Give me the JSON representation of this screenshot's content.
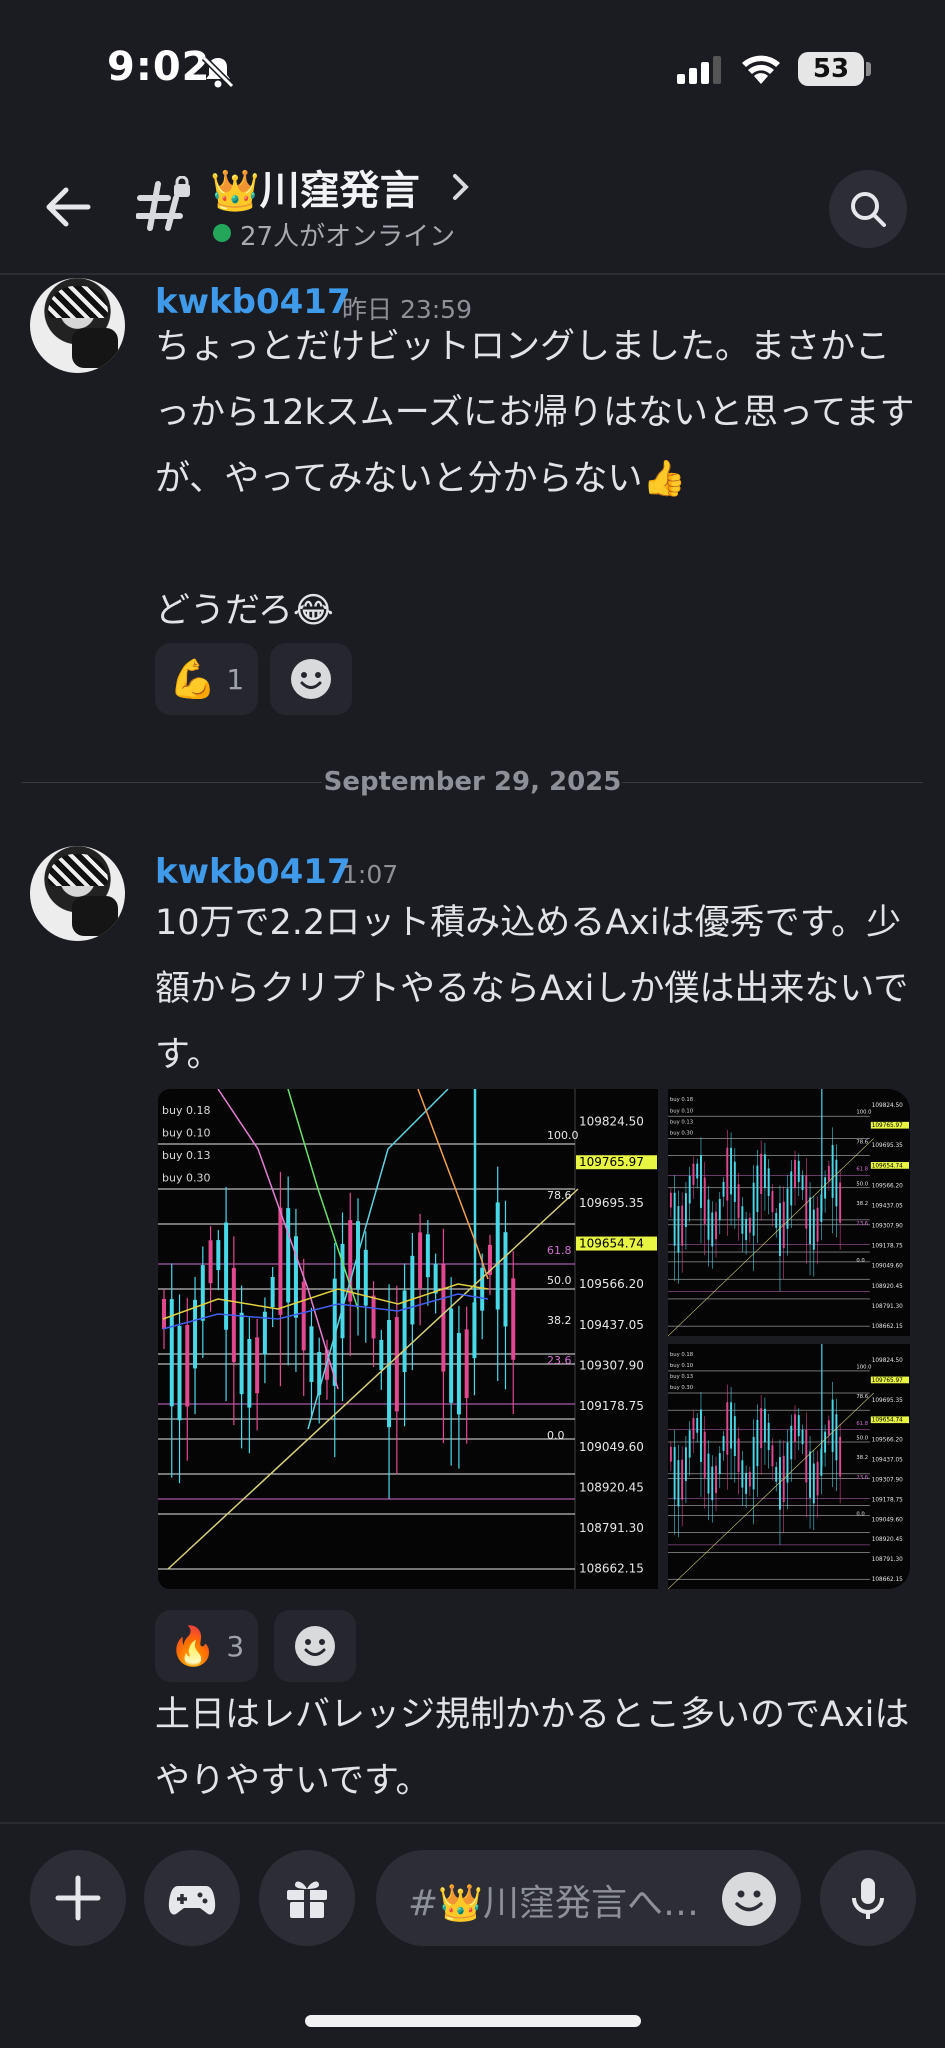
{
  "status_bar": {
    "time": "9:02",
    "battery": "53"
  },
  "header": {
    "channel_title": "👑川窪発言",
    "online_text": "27人がオンライン"
  },
  "messages": [
    {
      "username": "kwkb0417",
      "timestamp": "昨日 23:59",
      "text": "ちょっとだけビットロングしました。まさかこっから12kスムーズにお帰りはないと思ってますが、やってみないと分からない👍\n\nどうだろ😂",
      "reactions": [
        {
          "emoji": "💪",
          "count": "1"
        }
      ]
    },
    {
      "username": "kwkb0417",
      "timestamp": "1:07",
      "text": "10万で2.2ロット積み込めるAxiは優秀です。少額からクリプトやるならAxiしか僕は出来ないです。",
      "reactions": [
        {
          "emoji": "🔥",
          "count": "3"
        }
      ],
      "follow_text": "土日はレバレッジ規制かかるとこ多いのでAxiはやりやすいです。"
    }
  ],
  "date_divider": "September 29, 2025",
  "chart_image": {
    "price_labels": [
      "109824.50",
      "109765.97",
      "109695.35",
      "109654.74",
      "109566.20",
      "109437.05",
      "109307.90",
      "109178.75",
      "109049.60",
      "108920.45",
      "108791.30",
      "108662.15"
    ],
    "fib_labels": [
      "100.0",
      "78.6",
      "61.8",
      "50.0",
      "38.2",
      "23.6",
      "0.0"
    ],
    "order_labels": [
      "buy 0.18",
      "buy 0.10",
      "buy 0.13",
      "buy 0.30"
    ],
    "highlight_color": "#e8f542"
  },
  "composer": {
    "placeholder": "#👑川窪発言へ…"
  }
}
